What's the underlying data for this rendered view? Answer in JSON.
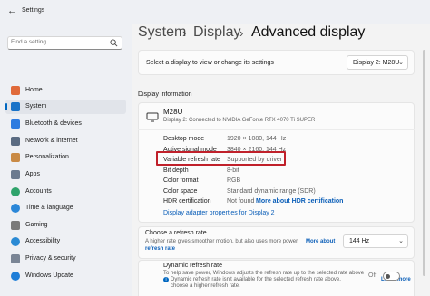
{
  "window": {
    "title": "Settings",
    "back_icon": "back-arrow-icon"
  },
  "search": {
    "placeholder": "Find a setting",
    "icon": "search-icon"
  },
  "sidebar": {
    "items": [
      {
        "label": "Home",
        "icon": "home-icon",
        "color": "#e06a3a"
      },
      {
        "label": "System",
        "icon": "monitor-icon",
        "color": "#1a73c8",
        "selected": true
      },
      {
        "label": "Bluetooth & devices",
        "icon": "bluetooth-icon",
        "color": "#2d7be0"
      },
      {
        "label": "Network & internet",
        "icon": "network-icon",
        "color": "#5a6b82"
      },
      {
        "label": "Personalization",
        "icon": "brush-icon",
        "color": "#c98a45"
      },
      {
        "label": "Apps",
        "icon": "apps-icon",
        "color": "#6b7a8f"
      },
      {
        "label": "Accounts",
        "icon": "account-icon",
        "color": "#2fa36b"
      },
      {
        "label": "Time & language",
        "icon": "clock-globe-icon",
        "color": "#2b87d8"
      },
      {
        "label": "Gaming",
        "icon": "controller-icon",
        "color": "#7a7a7a"
      },
      {
        "label": "Accessibility",
        "icon": "accessibility-icon",
        "color": "#2a8ad4"
      },
      {
        "label": "Privacy & security",
        "icon": "shield-icon",
        "color": "#7a8595"
      },
      {
        "label": "Windows Update",
        "icon": "update-icon",
        "color": "#1e7ed8"
      }
    ]
  },
  "breadcrumb": {
    "part1": "System",
    "sep1": "›",
    "part2": "Display",
    "sep2": "›",
    "current": "Advanced display"
  },
  "display_select": {
    "label": "Select a display to view or change its settings",
    "value": "Display 2: M28U"
  },
  "display_info": {
    "section_title": "Display information",
    "monitor_name": "M28U",
    "monitor_desc": "Display 2: Connected to NVIDIA GeForce RTX 4070 Ti SUPER",
    "rows": [
      {
        "label": "Desktop mode",
        "value": "1920 × 1080, 144 Hz"
      },
      {
        "label": "Active signal mode",
        "value": "3840 × 2160, 144 Hz"
      },
      {
        "label": "Variable refresh rate",
        "value": "Supported by driver"
      },
      {
        "label": "Bit depth",
        "value": "8-bit"
      },
      {
        "label": "Color format",
        "value": "RGB"
      },
      {
        "label": "Color space",
        "value": "Standard dynamic range (SDR)"
      },
      {
        "label": "HDR certification",
        "value": "Not found",
        "link": "More about HDR certification"
      }
    ],
    "adapter_link": "Display adapter properties for Display 2"
  },
  "refresh": {
    "title": "Choose a refresh rate",
    "desc1": "A higher rate gives smoother motion, but also uses more power",
    "more_link": "More about",
    "desc2_link": "refresh rate",
    "value": "144 Hz"
  },
  "dynamic": {
    "title": "Dynamic refresh rate",
    "desc1": "To help save power, Windows adjusts the refresh rate up to the selected rate above",
    "note": "Dynamic refresh rate isn't available for the selected refresh rate above.",
    "note_link": "Learn more",
    "note_tail": "choose a higher refresh rate.",
    "toggle_label": "Off",
    "toggle_on": false
  },
  "colors": {
    "accent": "#0067c0",
    "highlight_box": "#c0202a",
    "link": "#0a5eb8"
  }
}
